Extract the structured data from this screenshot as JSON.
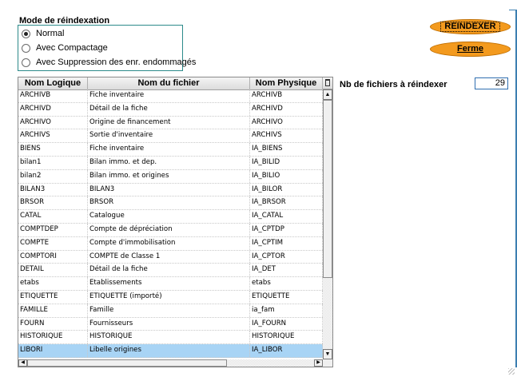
{
  "mode_group": {
    "title": "Mode de réindexation",
    "options": [
      {
        "label": "Normal",
        "checked": true
      },
      {
        "label": "Avec Compactage",
        "checked": false
      },
      {
        "label": "Avec Suppression des enr. endommagés",
        "checked": false
      }
    ]
  },
  "buttons": {
    "reindex": "REINDEXER",
    "close": "Ferme"
  },
  "count": {
    "label": "Nb de fichiers à réindexer",
    "value": "29"
  },
  "table": {
    "columns": [
      "Nom Logique",
      "Nom du fichier",
      "Nom Physique"
    ],
    "rows": [
      [
        "ARCHIVB",
        "Fiche inventaire",
        "ARCHIVB"
      ],
      [
        "ARCHIVD",
        "Détail de la fiche",
        "ARCHIVD"
      ],
      [
        "ARCHIVO",
        "Origine de financement",
        "ARCHIVO"
      ],
      [
        "ARCHIVS",
        "Sortie d'inventaire",
        "ARCHIVS"
      ],
      [
        "BIENS",
        "Fiche inventaire",
        "IA_BIENS"
      ],
      [
        "bilan1",
        "Bilan immo. et dep.",
        "IA_BILID"
      ],
      [
        "bilan2",
        "Bilan immo. et origines",
        "IA_BILIO"
      ],
      [
        "BILAN3",
        "BILAN3",
        "IA_BILOR"
      ],
      [
        "BRSOR",
        "BRSOR",
        "IA_BRSOR"
      ],
      [
        "CATAL",
        "Catalogue",
        "IA_CATAL"
      ],
      [
        "COMPTDEP",
        "Compte de dépréciation",
        "IA_CPTDP"
      ],
      [
        "COMPTE",
        "Compte d'immobilisation",
        "IA_CPTIM"
      ],
      [
        "COMPTORI",
        "COMPTE de Classe 1",
        "IA_CPTOR"
      ],
      [
        "DETAIL",
        "Détail de la fiche",
        "IA_DET"
      ],
      [
        "etabs",
        "Etablissements",
        "etabs"
      ],
      [
        "ETIQUETTE",
        "ETIQUETTE (importé)",
        "ETIQUETTE"
      ],
      [
        "FAMILLE",
        "Famille",
        "ia_fam"
      ],
      [
        "FOURN",
        "Fournisseurs",
        "IA_FOURN"
      ],
      [
        "HISTORIQUE",
        "HISTORIQUE",
        "HISTORIQUE"
      ],
      [
        "LIBORI",
        "Libelle origines",
        "IA_LIBOR"
      ]
    ],
    "selected_row": 19,
    "selection_color": "#a8d4f5"
  },
  "colors": {
    "button_fill": "#f39a1e",
    "group_border": "#2c8a8a",
    "field_border": "#2f6fb0"
  }
}
